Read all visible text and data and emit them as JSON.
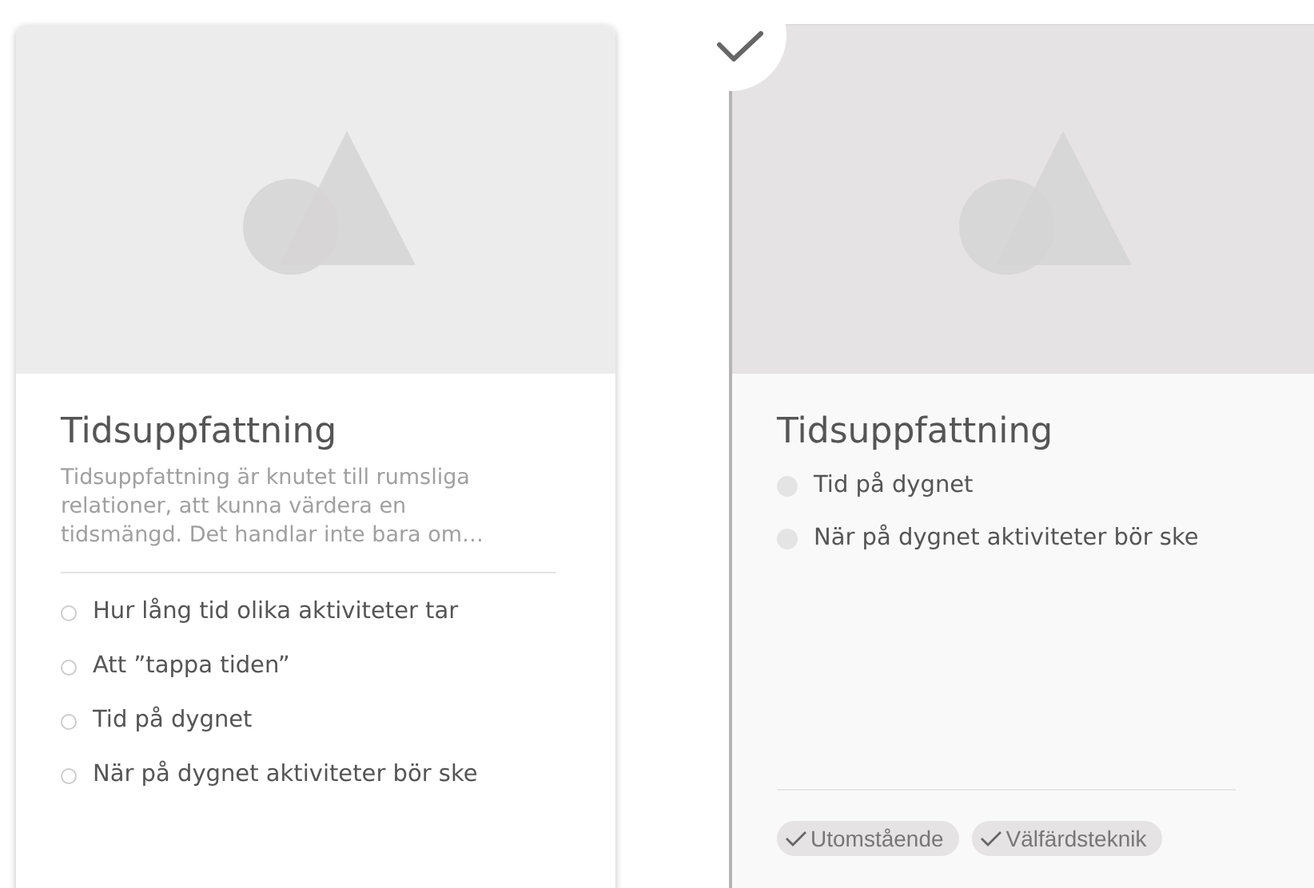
{
  "cards": [
    {
      "selected": false,
      "title": "Tidsuppfattning",
      "description": "Tidsuppfattning är knutet till rumsliga relationer, att kunna värdera en tidsmängd. Det handlar inte bara om…",
      "items": [
        "Hur lång tid olika aktiviteter tar",
        "Att ”tappa tiden”",
        "Tid på dygnet",
        "När på dygnet aktiviteter bör ske"
      ]
    },
    {
      "selected": true,
      "title": "Tidsuppfattning",
      "items": [
        "Tid på dygnet",
        "När på dygnet aktiviteter bör ske"
      ],
      "tags": [
        "Utomstående",
        "Välfärdsteknik"
      ]
    }
  ]
}
